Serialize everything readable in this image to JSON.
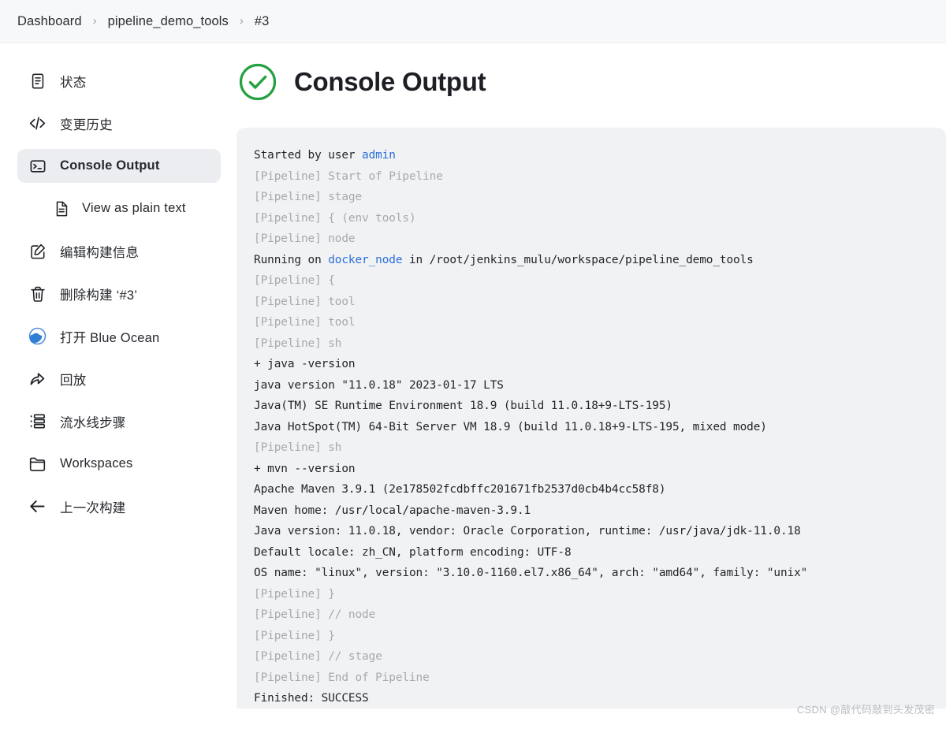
{
  "breadcrumb": {
    "separator": "›",
    "items": [
      {
        "label": "Dashboard"
      },
      {
        "label": "pipeline_demo_tools"
      },
      {
        "label": "#3"
      }
    ]
  },
  "sidebar": {
    "items": [
      {
        "label": "状态",
        "icon": "document-icon",
        "active": false,
        "sub": false
      },
      {
        "label": "变更历史",
        "icon": "code-icon",
        "active": false,
        "sub": false
      },
      {
        "label": "Console Output",
        "icon": "terminal-icon",
        "active": true,
        "sub": false
      },
      {
        "label": "View as plain text",
        "icon": "plain-text-file-icon",
        "active": false,
        "sub": true
      },
      {
        "label": "编辑构建信息",
        "icon": "edit-icon",
        "active": false,
        "sub": false
      },
      {
        "label": "删除构建 ‘#3’",
        "icon": "trash-icon",
        "active": false,
        "sub": false
      },
      {
        "label": "打开 Blue Ocean",
        "icon": "blue-ocean-icon",
        "active": false,
        "sub": false
      },
      {
        "label": "回放",
        "icon": "replay-icon",
        "active": false,
        "sub": false
      },
      {
        "label": "流水线步骤",
        "icon": "pipeline-steps-icon",
        "active": false,
        "sub": false
      },
      {
        "label": "Workspaces",
        "icon": "folder-icon",
        "active": false,
        "sub": false
      },
      {
        "label": "上一次构建",
        "icon": "arrow-left-icon",
        "active": false,
        "sub": false
      }
    ]
  },
  "main": {
    "title": "Console Output",
    "status_icon": "success-check-circle-icon",
    "status_color": "#23a03f"
  },
  "console": {
    "lines": [
      {
        "type": "normal",
        "segments": [
          {
            "text": "Started by user "
          },
          {
            "text": "admin",
            "link": true
          }
        ]
      },
      {
        "type": "meta",
        "segments": [
          {
            "text": "[Pipeline] Start of Pipeline"
          }
        ]
      },
      {
        "type": "meta",
        "segments": [
          {
            "text": "[Pipeline] stage"
          }
        ]
      },
      {
        "type": "meta",
        "segments": [
          {
            "text": "[Pipeline] { (env tools)"
          }
        ]
      },
      {
        "type": "meta",
        "segments": [
          {
            "text": "[Pipeline] node"
          }
        ]
      },
      {
        "type": "normal",
        "segments": [
          {
            "text": "Running on "
          },
          {
            "text": "docker_node",
            "link": true
          },
          {
            "text": " in /root/jenkins_mulu/workspace/pipeline_demo_tools"
          }
        ]
      },
      {
        "type": "meta",
        "segments": [
          {
            "text": "[Pipeline] {"
          }
        ]
      },
      {
        "type": "meta",
        "segments": [
          {
            "text": "[Pipeline] tool"
          }
        ]
      },
      {
        "type": "meta",
        "segments": [
          {
            "text": "[Pipeline] tool"
          }
        ]
      },
      {
        "type": "meta",
        "segments": [
          {
            "text": "[Pipeline] sh"
          }
        ]
      },
      {
        "type": "normal",
        "segments": [
          {
            "text": "+ java -version"
          }
        ]
      },
      {
        "type": "normal",
        "segments": [
          {
            "text": "java version \"11.0.18\" 2023-01-17 LTS"
          }
        ]
      },
      {
        "type": "normal",
        "segments": [
          {
            "text": "Java(TM) SE Runtime Environment 18.9 (build 11.0.18+9-LTS-195)"
          }
        ]
      },
      {
        "type": "normal",
        "segments": [
          {
            "text": "Java HotSpot(TM) 64-Bit Server VM 18.9 (build 11.0.18+9-LTS-195, mixed mode)"
          }
        ]
      },
      {
        "type": "meta",
        "segments": [
          {
            "text": "[Pipeline] sh"
          }
        ]
      },
      {
        "type": "normal",
        "segments": [
          {
            "text": "+ mvn --version"
          }
        ]
      },
      {
        "type": "normal",
        "segments": [
          {
            "text": "Apache Maven 3.9.1 (2e178502fcdbffc201671fb2537d0cb4b4cc58f8)"
          }
        ]
      },
      {
        "type": "normal",
        "segments": [
          {
            "text": "Maven home: /usr/local/apache-maven-3.9.1"
          }
        ]
      },
      {
        "type": "normal",
        "segments": [
          {
            "text": "Java version: 11.0.18, vendor: Oracle Corporation, runtime: /usr/java/jdk-11.0.18"
          }
        ]
      },
      {
        "type": "normal",
        "segments": [
          {
            "text": "Default locale: zh_CN, platform encoding: UTF-8"
          }
        ]
      },
      {
        "type": "normal",
        "segments": [
          {
            "text": "OS name: \"linux\", version: \"3.10.0-1160.el7.x86_64\", arch: \"amd64\", family: \"unix\""
          }
        ]
      },
      {
        "type": "meta",
        "segments": [
          {
            "text": "[Pipeline] }"
          }
        ]
      },
      {
        "type": "meta",
        "segments": [
          {
            "text": "[Pipeline] // node"
          }
        ]
      },
      {
        "type": "meta",
        "segments": [
          {
            "text": "[Pipeline] }"
          }
        ]
      },
      {
        "type": "meta",
        "segments": [
          {
            "text": "[Pipeline] // stage"
          }
        ]
      },
      {
        "type": "meta",
        "segments": [
          {
            "text": "[Pipeline] End of Pipeline"
          }
        ]
      },
      {
        "type": "normal",
        "segments": [
          {
            "text": "Finished: SUCCESS"
          }
        ]
      }
    ]
  },
  "watermark": {
    "text": "CSDN @敲代码敲到头发茂密"
  }
}
